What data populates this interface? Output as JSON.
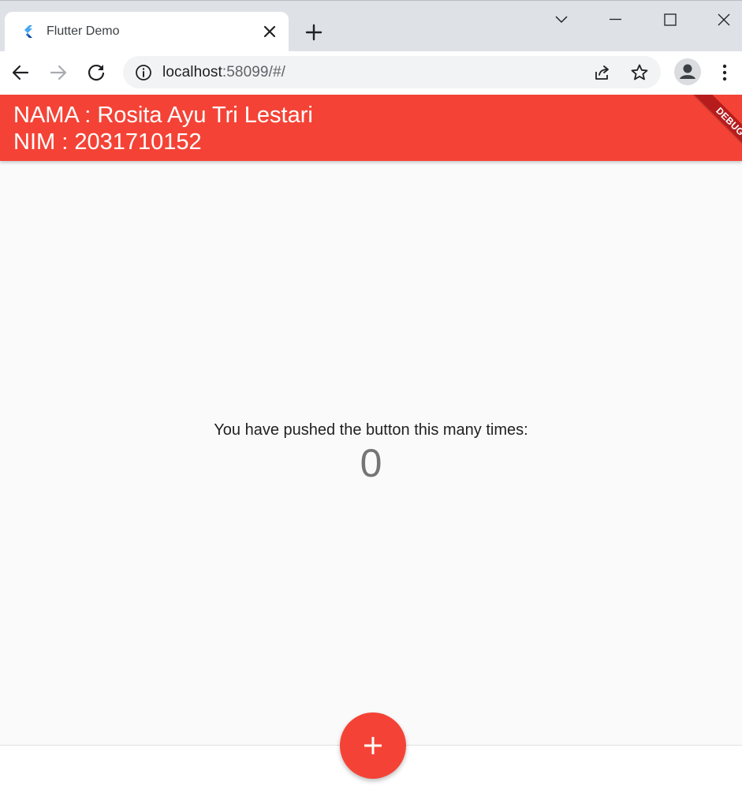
{
  "browser": {
    "tab": {
      "title": "Flutter Demo",
      "favicon": "flutter-logo-icon"
    },
    "new_tab_icon": "plus-icon",
    "window_controls": [
      "chevron-down-icon",
      "minimize-icon",
      "maximize-icon",
      "close-icon"
    ],
    "toolbar": {
      "back_icon": "arrow-left-icon",
      "forward_icon": "arrow-right-icon",
      "reload_icon": "reload-icon",
      "site_info_icon": "info-icon",
      "url_host": "localhost",
      "url_path": ":58099/#/",
      "share_icon": "share-icon",
      "bookmark_icon": "star-icon",
      "profile_icon": "person-icon",
      "menu_icon": "kebab-menu-icon"
    }
  },
  "app": {
    "appbar": {
      "line1": "NAMA : Rosita Ayu Tri Lestari",
      "line2": "NIM : 2031710152",
      "debug_banner": "DEBUG"
    },
    "body": {
      "counter_label": "You have pushed the button this many times:",
      "counter_value": "0"
    },
    "fab_icon": "plus-icon"
  },
  "colors": {
    "primary": "#f44336",
    "background": "#fafafa",
    "tabstrip": "#dee1e6",
    "omnibox": "#f1f3f4"
  }
}
